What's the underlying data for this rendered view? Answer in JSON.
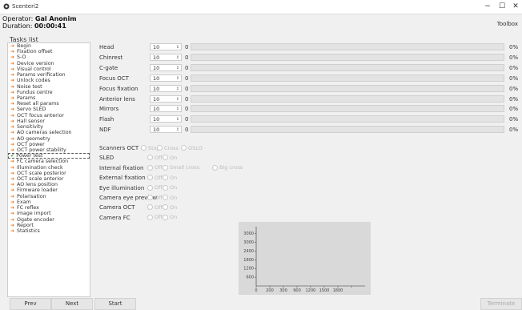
{
  "window": {
    "title": "Scenteri2",
    "minimize": "−",
    "maximize": "☐",
    "close": "✕"
  },
  "operator": {
    "prefix": "Operator: ",
    "name": "Gal Anonim",
    "duration_prefix": "Duration: ",
    "duration": "00:00:41"
  },
  "toolbox_label": "Toolbox",
  "tasks_label": "Tasks list",
  "tasks": [
    "Begin",
    "Fixation offset",
    "S-O",
    "Device version",
    "Visual control",
    "Params verification",
    "Unlock codes",
    "Noise test",
    "Fundus centre",
    "Params",
    "Reset all params",
    "Servo SLED",
    "OCT focus anterior",
    "Hall sensor",
    "Sensitivity",
    "AO cameras selection",
    "AO geometry",
    "OCT power",
    "OCT power stability",
    "Power test",
    "FC camera selection",
    "Illumination check",
    "OCT scale posterior",
    "OCT scale anterior",
    "AO lens position",
    "Firmware loader",
    "Polarisation",
    "Exam",
    "FC reflex",
    "Image import",
    "Ogate encoder",
    "Report",
    "Statistics"
  ],
  "selected_task_index": 19,
  "buttons": {
    "prev": "Prev",
    "next": "Next",
    "start": "Start",
    "terminate": "Terminate"
  },
  "params": [
    {
      "label": "Head",
      "value": "10",
      "current": "0",
      "pct": "0%"
    },
    {
      "label": "Chinrest",
      "value": "10",
      "current": "0",
      "pct": "0%"
    },
    {
      "label": "C-gate",
      "value": "10",
      "current": "0",
      "pct": "0%"
    },
    {
      "label": "Focus OCT",
      "value": "10",
      "current": "0",
      "pct": "0%"
    },
    {
      "label": "Focus fixation",
      "value": "10",
      "current": "0",
      "pct": "0%"
    },
    {
      "label": "Anterior lens",
      "value": "10",
      "current": "0",
      "pct": "0%"
    },
    {
      "label": "Mirrors",
      "value": "10",
      "current": "0",
      "pct": "0%"
    },
    {
      "label": "Flash",
      "value": "10",
      "current": "0",
      "pct": "0%"
    },
    {
      "label": "NDF",
      "value": "10",
      "current": "0",
      "pct": "0%"
    }
  ],
  "toggles": [
    {
      "label": "Scanners OCT",
      "options": [
        "Stop",
        "Cross",
        "OSLO"
      ]
    },
    {
      "label": "SLED",
      "options": [
        "Off",
        "On"
      ]
    },
    {
      "label": "Internal fixation",
      "options": [
        "Off",
        "Small cross",
        "Big cross"
      ]
    },
    {
      "label": "External fixation",
      "options": [
        "Off",
        "On"
      ]
    },
    {
      "label": "Eye illumination",
      "options": [
        "Off",
        "On"
      ]
    },
    {
      "label": "Camera eye preview",
      "options": [
        "Off",
        "On"
      ]
    },
    {
      "label": "Camera OCT",
      "options": [
        "Off",
        "On"
      ]
    },
    {
      "label": "Camera FC",
      "options": [
        "Off",
        "On"
      ]
    }
  ],
  "chart_data": {
    "type": "line",
    "x": [],
    "y": [],
    "xlim": [
      0,
      1600
    ],
    "ylim": [
      0,
      3400
    ],
    "xticks": [
      0,
      200,
      400,
      600,
      800,
      1000,
      1200,
      1400
    ],
    "xtick_labels": [
      "0",
      "200",
      "300",
      "900",
      "1200",
      "1500",
      "1800"
    ],
    "yticks": [
      3000,
      2500,
      2000,
      1500,
      1000,
      500
    ],
    "ytick_labels": [
      "3000",
      "3000",
      "2400",
      "1800",
      "1200",
      "600"
    ],
    "background": "#d9d9d9",
    "grid": false
  },
  "colors": {
    "arrow": "#e8731a",
    "check": "#2a9a2a"
  }
}
